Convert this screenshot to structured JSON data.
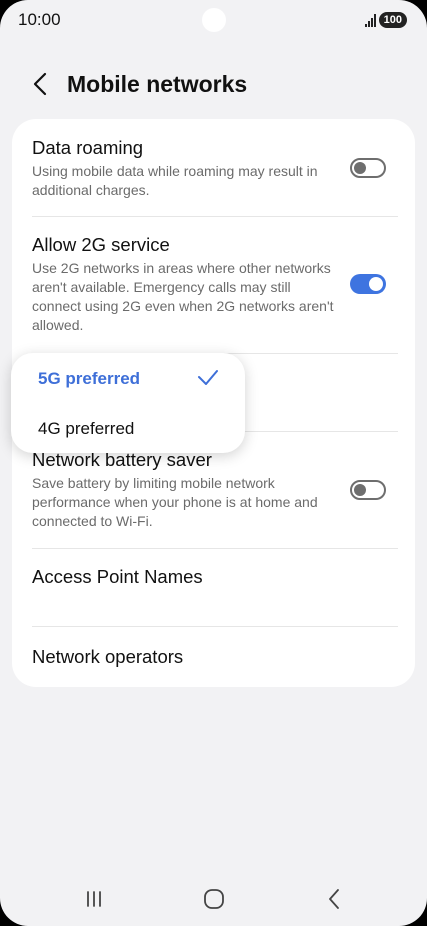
{
  "status_bar": {
    "time": "10:00",
    "battery": "100"
  },
  "header": {
    "title": "Mobile networks"
  },
  "settings": {
    "data_roaming": {
      "title": "Data roaming",
      "description": "Using mobile data while roaming may result in additional charges.",
      "enabled": false
    },
    "allow_2g": {
      "title": "Allow 2G service",
      "description": "Use 2G networks in areas where other networks aren't available. Emergency calls may still connect using 2G even when 2G networks aren't allowed.",
      "enabled": true
    },
    "network_battery_saver": {
      "title": "Network battery saver",
      "description": "Save battery by limiting mobile network performance when your phone is at home and connected to Wi-Fi.",
      "enabled": false
    },
    "access_point_names": {
      "title": "Access Point Names"
    },
    "network_operators": {
      "title": "Network operators"
    }
  },
  "network_mode_dropdown": {
    "options": [
      {
        "label": "5G preferred",
        "selected": true
      },
      {
        "label": "4G preferred",
        "selected": false
      }
    ]
  },
  "colors": {
    "accent": "#3e74e0",
    "selected_text": "#3e6fd8",
    "background": "#f2f2f4",
    "card": "#ffffff"
  },
  "icons": {
    "back": "chevron-left-icon",
    "check": "check-icon",
    "nav_recents": "recents-icon",
    "nav_home": "home-icon",
    "nav_back": "back-icon"
  }
}
